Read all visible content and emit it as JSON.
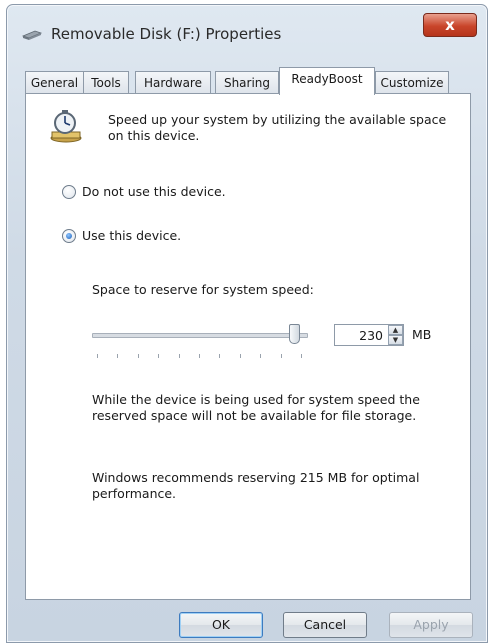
{
  "window": {
    "title": "Removable Disk (F:) Properties",
    "close_label": "x"
  },
  "tabs": [
    {
      "label": "General"
    },
    {
      "label": "Tools"
    },
    {
      "label": "Hardware"
    },
    {
      "label": "Sharing"
    },
    {
      "label": "ReadyBoost"
    },
    {
      "label": "Customize"
    }
  ],
  "active_tab": "ReadyBoost",
  "readyboost": {
    "icon": "stopwatch-drive-icon",
    "intro": "Speed up your system by utilizing the available space on this device.",
    "options": [
      {
        "label": "Do not use this device.",
        "checked": false
      },
      {
        "label": "Use this device.",
        "checked": true
      }
    ],
    "reserve_label": "Space to reserve for system speed:",
    "reserve_value": "230",
    "reserve_unit": "MB",
    "slider_level": 0.97,
    "note_storage": "While the device is being used for system speed the reserved space will not be available for file storage.",
    "note_recommend": "Windows recommends reserving 215 MB for optimal performance."
  },
  "buttons": {
    "ok": "OK",
    "cancel": "Cancel",
    "apply": "Apply"
  }
}
